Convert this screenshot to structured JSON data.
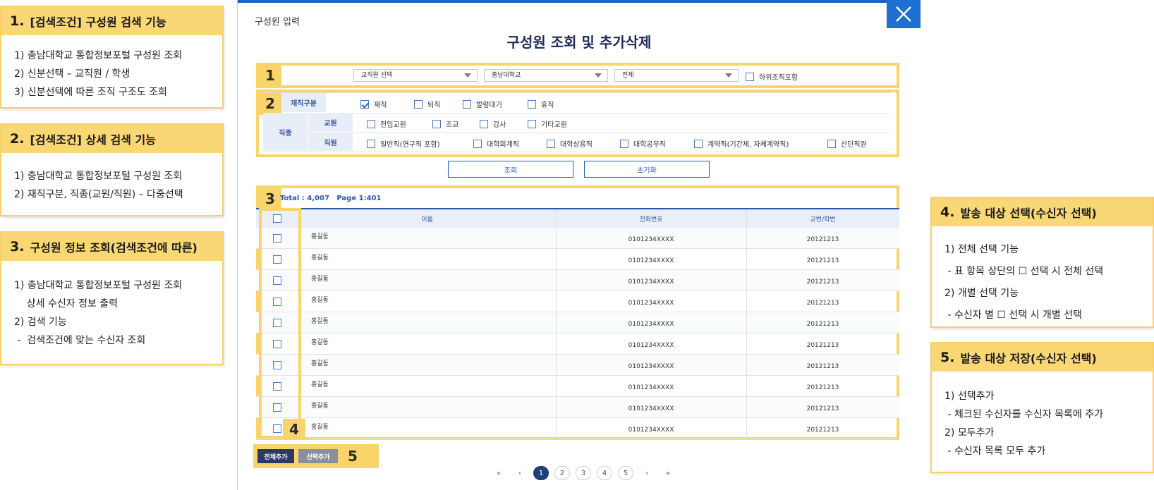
{
  "cards": [
    {
      "num": "1.",
      "title": "[검색조건] 구성원 검색 기능",
      "lines": [
        "1) 충남대학교 통합정보포털 구성원 조회",
        "2) 신분선택 – 교직원 / 학생",
        "3) 신분선택에 따른 조직 구조도 조회"
      ]
    },
    {
      "num": "2.",
      "title": "[검색조건] 상세 검색 기능",
      "lines": [
        "1) 충남대학교 통합정보포털 구성원 조회",
        "2) 재직구분, 직종(교원/직원) – 다중선택"
      ]
    },
    {
      "num": "3.",
      "title": "구성원 정보 조회(검색조건에 따른)",
      "lines": [
        "1) 충남대학교 통합정보포털 구성원 조회",
        "    상세 수신자 정보 출력",
        "2) 검색 기능",
        " -  검색조건에 맞는 수신자 조회"
      ]
    },
    {
      "num": "4.",
      "title": "발송 대상 선택(수신자 선택)",
      "lines": [
        "1) 전체 선택 기능",
        " - 표 항목 상단의 ☐ 선택 시 전체 선택",
        "2) 개별 선택 기능",
        " - 수신자 별 ☐ 선택 시 개별 선택"
      ]
    },
    {
      "num": "5.",
      "title": "발송 대상 저장(수신자 선택)",
      "lines": [
        "1) 선택추가",
        " - 체크된 수신자를 수신자 목록에 추가",
        "2) 모두추가",
        " - 수신자 목록 모두 추가"
      ]
    }
  ],
  "popup": {
    "label": "구성원 입력",
    "title": "구성원 조회 및 추가삭제",
    "badges": [
      "1",
      "2",
      "3",
      "4",
      "5"
    ]
  },
  "filters": {
    "status_select": "교직원 선택",
    "org_select": "충남대학교",
    "sub_select": "전체",
    "include_sub_label": "하위조직포함",
    "include_sub_checked": false
  },
  "categories": {
    "employment_header": "재직구분",
    "job_header": "직종",
    "faculty_header": "교원",
    "staff_header": "직원",
    "employment_options": [
      {
        "label": "재직",
        "checked": true
      },
      {
        "label": "퇴직",
        "checked": false
      },
      {
        "label": "발령대기",
        "checked": false
      },
      {
        "label": "휴직",
        "checked": false
      }
    ],
    "faculty_options": [
      {
        "label": "전임교원",
        "checked": false
      },
      {
        "label": "조교",
        "checked": false
      },
      {
        "label": "강사",
        "checked": false
      },
      {
        "label": "기타교원",
        "checked": false
      }
    ],
    "staff_options": [
      {
        "label": "일반직(연구직 포함)",
        "checked": false
      },
      {
        "label": "대학회계직",
        "checked": false
      },
      {
        "label": "대학상용직",
        "checked": false
      },
      {
        "label": "대학공무직",
        "checked": false
      },
      {
        "label": "계약직(기간제, 자체계약직)",
        "checked": false
      },
      {
        "label": "산단직원",
        "checked": false
      }
    ]
  },
  "actions": {
    "search": "조회",
    "reset": "초기화"
  },
  "results": {
    "total_label": "Total : ",
    "total_value": "4,007",
    "page_label": "Page 1:401",
    "columns": [
      "이름",
      "전화번호",
      "교번/학번"
    ],
    "rows": [
      {
        "name": "홍길동",
        "phone": "0101234XXXX",
        "id": "20121213"
      },
      {
        "name": "홍길동",
        "phone": "0101234XXXX",
        "id": "20121213"
      },
      {
        "name": "홍길동",
        "phone": "0101234XXXX",
        "id": "20121213"
      },
      {
        "name": "홍길동",
        "phone": "0101234XXXX",
        "id": "20121213"
      },
      {
        "name": "홍길동",
        "phone": "0101234XXXX",
        "id": "20121213"
      },
      {
        "name": "홍길동",
        "phone": "0101234XXXX",
        "id": "20121213"
      },
      {
        "name": "홍길동",
        "phone": "0101234XXXX",
        "id": "20121213"
      },
      {
        "name": "홍길동",
        "phone": "0101234XXXX",
        "id": "20121213"
      },
      {
        "name": "홍길동",
        "phone": "0101234XXXX",
        "id": "20121213"
      },
      {
        "name": "홍길동",
        "phone": "0101234XXXX",
        "id": "20121213"
      }
    ]
  },
  "bottom_buttons": {
    "add_all": "전체추가",
    "add_selected": "선택추가"
  },
  "pagination": {
    "first": "«",
    "prev": "‹",
    "pages": [
      "1",
      "2",
      "3",
      "4",
      "5"
    ],
    "active_page": "1",
    "next": "›",
    "last": "»"
  },
  "colors": {
    "accent": "#1f62c7",
    "highlight": "#f9d46a",
    "dark_button": "#2a3a63",
    "gray_button": "#8a8f99"
  }
}
